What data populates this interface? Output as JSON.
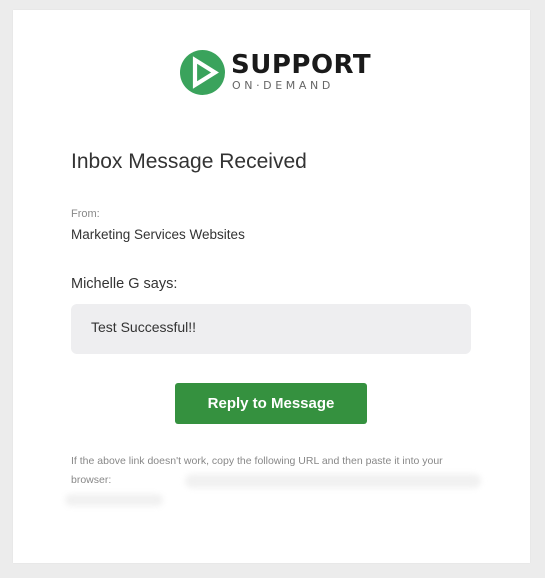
{
  "logo": {
    "name": "SUPPORT",
    "tagline": "ON·DEMAND",
    "color": "#3aa35c"
  },
  "email": {
    "title": "Inbox Message Received",
    "from_label": "From:",
    "from_value": "Marketing Services Websites",
    "sender_says": "Michelle G says:",
    "message": "Test Successful!!",
    "reply_button_label": "Reply to Message",
    "footer_note": "If the above link doesn't work, copy the following URL and then paste it into your browser:"
  },
  "colors": {
    "button": "#35913f",
    "message_bg": "#eeeef0"
  }
}
